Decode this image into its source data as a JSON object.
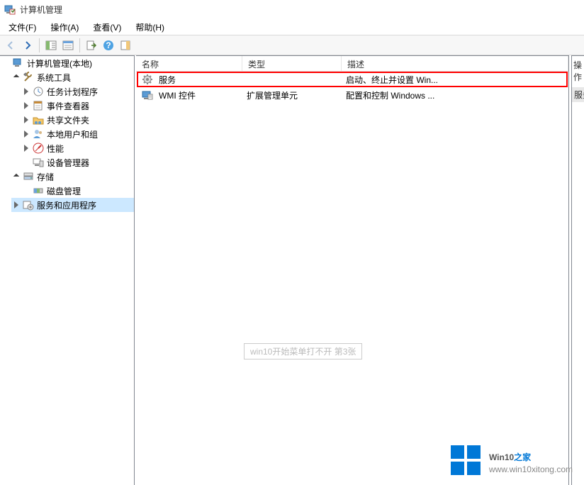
{
  "window": {
    "title": "计算机管理"
  },
  "menu": {
    "file": "文件(F)",
    "action": "操作(A)",
    "view": "查看(V)",
    "help": "帮助(H)"
  },
  "tree": {
    "root": "计算机管理(本地)",
    "system_tools": "系统工具",
    "task_scheduler": "任务计划程序",
    "event_viewer": "事件查看器",
    "shared_folders": "共享文件夹",
    "local_users": "本地用户和组",
    "performance": "性能",
    "device_manager": "设备管理器",
    "storage": "存储",
    "disk_mgmt": "磁盘管理",
    "services_apps": "服务和应用程序"
  },
  "list": {
    "columns": {
      "name": "名称",
      "type": "类型",
      "desc": "描述"
    },
    "rows": [
      {
        "name": "服务",
        "type": "",
        "desc": "启动、终止并设置 Win..."
      },
      {
        "name": "WMI 控件",
        "type": "扩展管理单元",
        "desc": "配置和控制 Windows ..."
      }
    ]
  },
  "right": {
    "header": "操作",
    "item": "服务"
  },
  "watermark": "win10开始菜单打不开 第3张",
  "brand": {
    "title_prefix": "Win10",
    "title_suffix": "之家",
    "url": "www.win10xitong.com"
  }
}
